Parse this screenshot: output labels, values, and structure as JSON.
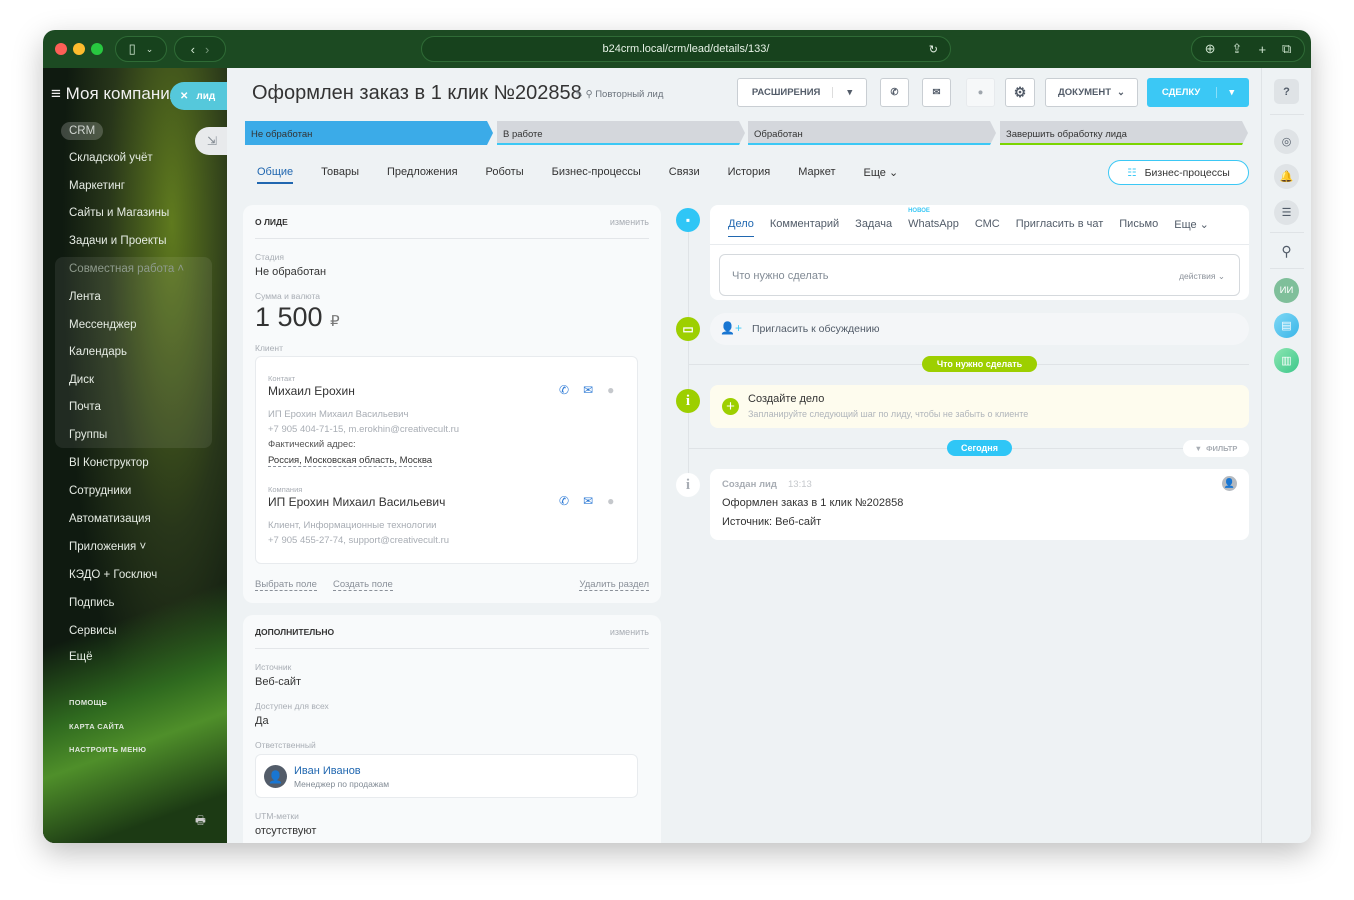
{
  "browser": {
    "url": "b24crm.local/crm/lead/details/133/"
  },
  "sidebar": {
    "company": "Моя компания",
    "crm": "CRM",
    "lead_tab": "лид",
    "items": [
      "Складской учёт",
      "Маркетинг",
      "Сайты и Магазины",
      "Задачи и Проекты"
    ],
    "group_title": "Совместная работа",
    "group_items": [
      "Лента",
      "Мессенджер",
      "Календарь",
      "Диск",
      "Почта",
      "Группы"
    ],
    "items2": [
      "BI Конструктор",
      "Сотрудники",
      "Автоматизация",
      "Приложения",
      "КЭДО + Госключ",
      "Подпись",
      "Сервисы",
      "Ещё"
    ],
    "bottom": [
      "ПОМОЩЬ",
      "КАРТА САЙТА",
      "НАСТРОИТЬ МЕНЮ"
    ]
  },
  "header": {
    "title": "Оформлен заказ в 1 клик №202858",
    "repeat": "Повторный лид",
    "extensions": "РАСШИРЕНИЯ",
    "document": "ДОКУМЕНТ",
    "deal": "СДЕЛКУ"
  },
  "stages": [
    {
      "label": "Не обработан",
      "color": "#3babe8"
    },
    {
      "label": "В работе",
      "color": "#d4d7dc"
    },
    {
      "label": "Обработан",
      "color": "#d4d7dc"
    },
    {
      "label": "Завершить обработку лида",
      "color": "#d4d7dc"
    }
  ],
  "tabs": [
    "Общие",
    "Товары",
    "Предложения",
    "Роботы",
    "Бизнес-процессы",
    "Связи",
    "История",
    "Маркет",
    "Еще"
  ],
  "bp_button": "Бизнес-процессы",
  "about": {
    "title": "О ЛИДЕ",
    "edit": "изменить",
    "stage_label": "Стадия",
    "stage": "Не обработан",
    "sum_label": "Сумма и валюта",
    "sum": "1 500",
    "currency": "₽",
    "client_label": "Клиент",
    "contact": {
      "label": "Контакт",
      "name": "Михаил Ерохин",
      "company": "ИП Ерохин Михаил Васильевич",
      "phone_email": "+7 905 404-71-15, m.erokhin@creativecult.ru",
      "address_label": "Фактический адрес:",
      "address": "Россия, Московская область, Москва"
    },
    "company": {
      "label": "Компания",
      "name": "ИП Ерохин Михаил Васильевич",
      "type": "Клиент, Информационные технологии",
      "phone_email": "+7 905 455-27-74, support@creativecult.ru"
    },
    "select_field": "Выбрать поле",
    "create_field": "Создать поле",
    "delete_section": "Удалить раздел"
  },
  "extra": {
    "title": "ДОПОЛНИТЕЛЬНО",
    "edit": "изменить",
    "source_label": "Источник",
    "source": "Веб-сайт",
    "public_label": "Доступен для всех",
    "public": "Да",
    "resp_label": "Ответственный",
    "resp_name": "Иван Иванов",
    "resp_pos": "Менеджер по продажам",
    "utm_label": "UTM-метки",
    "utm": "отсутствуют"
  },
  "timeline": {
    "tabs": [
      "Дело",
      "Комментарий",
      "Задача",
      "WhatsApp",
      "СМС",
      "Пригласить в чат",
      "Письмо",
      "Еще"
    ],
    "new_badge": "НОВОЕ",
    "input_placeholder": "Что нужно сделать",
    "actions": "действия",
    "invite": "Пригласить к обсуждению",
    "todo_badge": "Что нужно сделать",
    "create_title": "Создайте дело",
    "create_sub": "Запланируйте следующий шаг по лиду, чтобы не забыть о клиенте",
    "today": "Сегодня",
    "filter": "ФИЛЬТР",
    "created_title": "Создан лид",
    "created_time": "13:13",
    "created_line1": "Оформлен заказ в 1 клик №202858",
    "created_line2": "Источник: Веб-сайт"
  },
  "rail": {
    "ai": "ИИ"
  }
}
